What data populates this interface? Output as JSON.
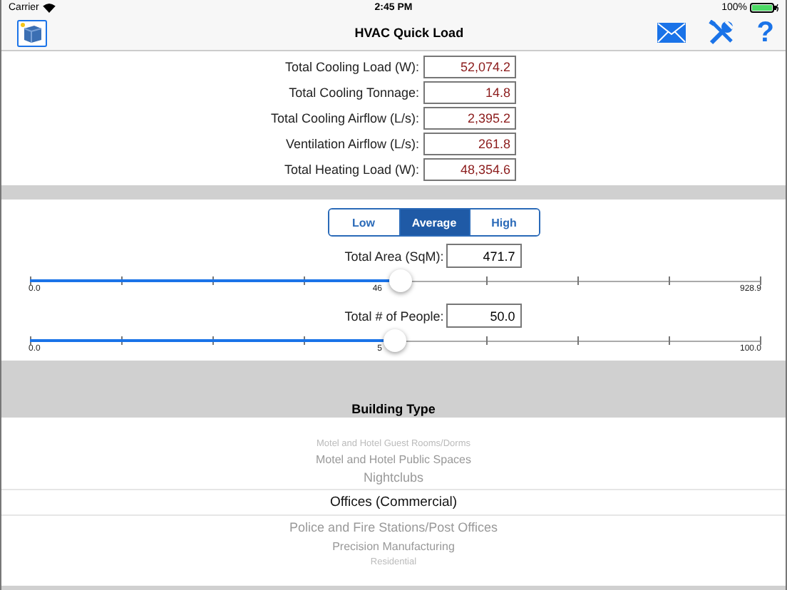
{
  "status_bar": {
    "carrier": "Carrier",
    "time": "2:45 PM",
    "battery": "100%"
  },
  "nav_bar": {
    "title": "HVAC Quick Load",
    "help": "?"
  },
  "results": [
    {
      "label": "Total Cooling Load (W):",
      "value": "52,074.2"
    },
    {
      "label": "Total Cooling Tonnage:",
      "value": "14.8"
    },
    {
      "label": "Total Cooling Airflow (L/s):",
      "value": "2,395.2"
    },
    {
      "label": "Ventilation Airflow (L/s):",
      "value": "261.8"
    },
    {
      "label": "Total Heating Load (W):",
      "value": "48,354.6"
    }
  ],
  "segments": [
    {
      "label": "Low",
      "selected": false
    },
    {
      "label": "Average",
      "selected": true
    },
    {
      "label": "High",
      "selected": false
    }
  ],
  "sliders": [
    {
      "label": "Total Area (SqM):",
      "value": "471.7",
      "level": 0.508,
      "min": "0.0",
      "mid": "46",
      "max": "928.9"
    },
    {
      "label": "Total # of People:",
      "value": "50.0",
      "level": 0.5,
      "min": "0.0",
      "mid": "5",
      "max": "100.0"
    }
  ],
  "building_type": {
    "title": "Building Type",
    "items": [
      {
        "label": "Motel and Hotel Guest Rooms/Dorms",
        "selected": false
      },
      {
        "label": "Motel and Hotel Public Spaces",
        "selected": false
      },
      {
        "label": "Nightclubs",
        "selected": false
      },
      {
        "label": "Offices (Commercial)",
        "selected": true
      },
      {
        "label": "Police and Fire Stations/Post Offices",
        "selected": false
      },
      {
        "label": "Precision Manufacturing",
        "selected": false
      },
      {
        "label": "Residential",
        "selected": false
      }
    ]
  }
}
